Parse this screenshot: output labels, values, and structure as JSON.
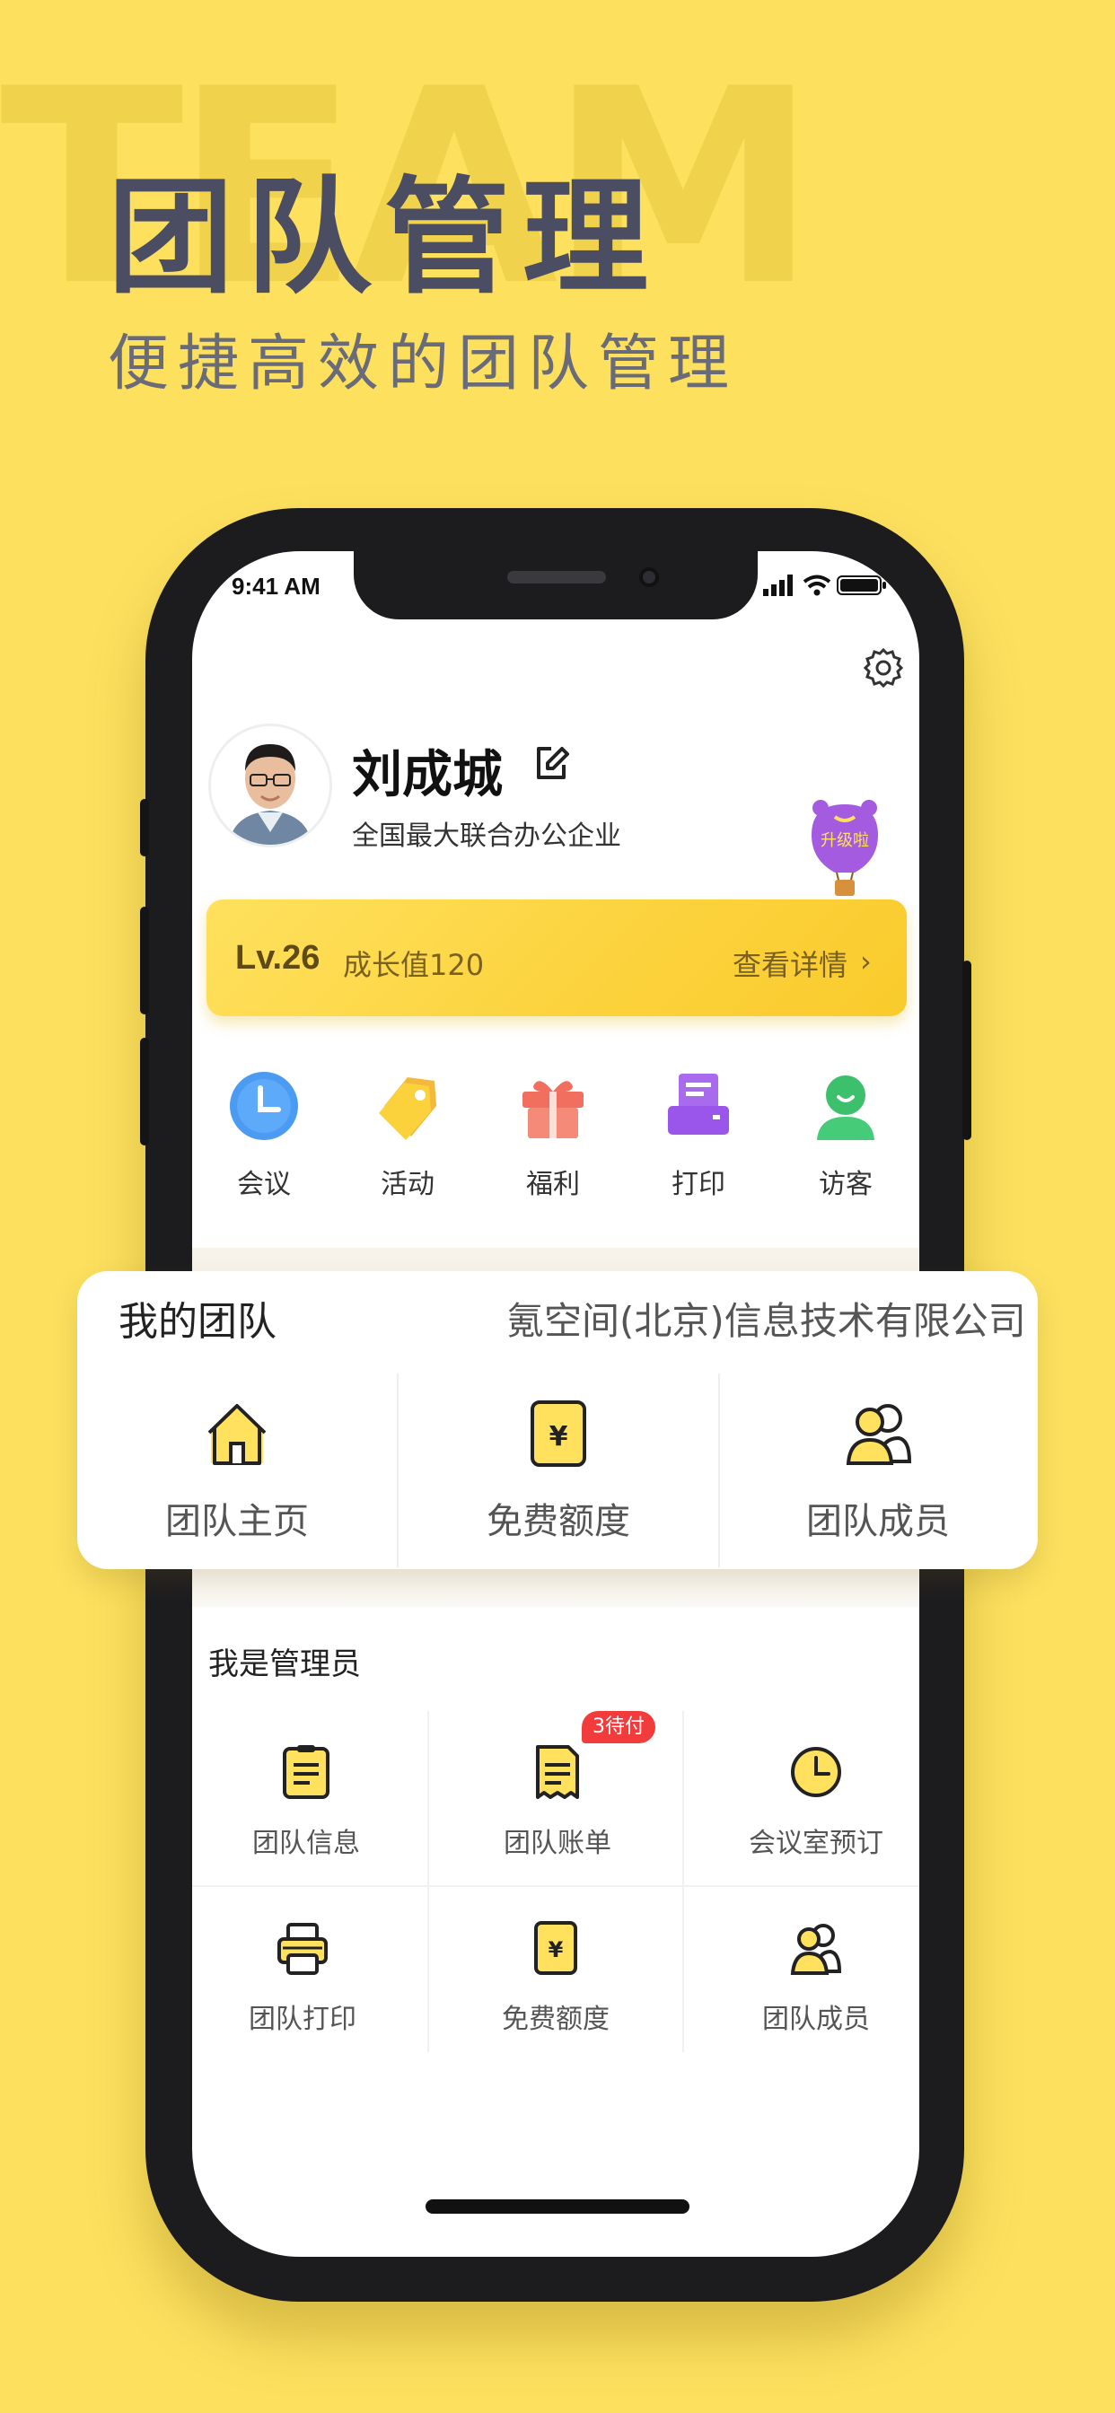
{
  "hero": {
    "bg_word": "TEAM",
    "title": "团队管理",
    "subtitle": "便捷高效的团队管理"
  },
  "status_bar": {
    "time": "9:41 AM"
  },
  "profile": {
    "name": "刘成城",
    "company": "全国最大联合办公企业",
    "balloon_label": "升级啦"
  },
  "level": {
    "level_text": "Lv.26",
    "growth_text": "成长值120",
    "detail_text": "查看详情",
    "arrow": "›"
  },
  "quick_actions": [
    {
      "label": "会议",
      "icon": "clock-icon"
    },
    {
      "label": "活动",
      "icon": "tag-icon"
    },
    {
      "label": "福利",
      "icon": "gift-icon"
    },
    {
      "label": "打印",
      "icon": "printer-icon"
    },
    {
      "label": "访客",
      "icon": "visitor-icon"
    }
  ],
  "team_card": {
    "title": "我的团队",
    "company": "氪空间(北京)信息技术有限公司",
    "items": [
      {
        "label": "团队主页",
        "icon": "home-icon"
      },
      {
        "label": "免费额度",
        "icon": "yen-icon"
      },
      {
        "label": "团队成员",
        "icon": "members-icon"
      }
    ]
  },
  "admin": {
    "title": "我是管理员",
    "badge": "3待付",
    "items": [
      {
        "label": "团队信息",
        "icon": "document-icon"
      },
      {
        "label": "团队账单",
        "icon": "bill-icon"
      },
      {
        "label": "会议室预订",
        "icon": "clock-icon"
      },
      {
        "label": "团队打印",
        "icon": "printer-icon"
      },
      {
        "label": "免费额度",
        "icon": "yen-icon"
      },
      {
        "label": "团队成员",
        "icon": "members-icon"
      }
    ]
  },
  "colors": {
    "background": "#FCE05E",
    "title": "#4B4D63",
    "accent_yellow": "#FCD23C",
    "badge_red": "#F23B3B"
  }
}
